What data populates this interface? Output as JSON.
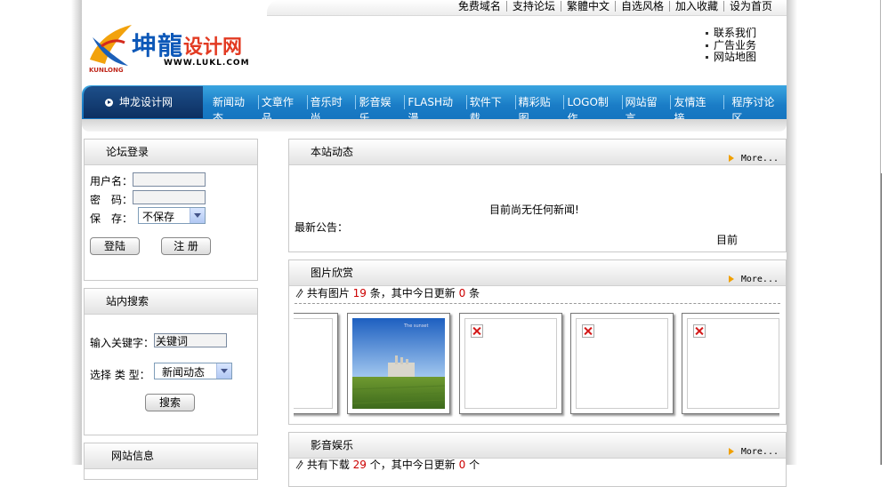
{
  "toplinks": [
    "免费域名",
    "支持论坛",
    "繁體中文",
    "自选风格",
    "加入收藏",
    "设为首页"
  ],
  "logo": {
    "cn": "坤龍",
    "design": "设计网",
    "url": "WWW.LUKL.COM",
    "en": "KUNLONG"
  },
  "quicklinks": [
    "联系我们",
    "广告业务",
    "网站地图"
  ],
  "nav": {
    "home": "坤龙设计网",
    "items": [
      "新闻动态",
      "文章作品",
      "音乐时尚",
      "影音娱乐",
      "FLASH动漫",
      "软件下载",
      "精彩贴图",
      "LOGO制作",
      "网站留言",
      "友情连接",
      "程序讨论区"
    ]
  },
  "login": {
    "title": "论坛登录",
    "username_label": "用户名：",
    "password_label": "密　码：",
    "save_label": "保　存：",
    "save_value": "不保存",
    "login_button": "登陆",
    "register_button": "注 册"
  },
  "search": {
    "title": "站内搜索",
    "keyword_label": "输入关键字：",
    "keyword_value": "关键词",
    "type_label": "选择 类 型：",
    "type_value": "新闻动态",
    "search_button": "搜索"
  },
  "siteinfo": {
    "title": "网站信息"
  },
  "news": {
    "title": "本站动态",
    "more": "More...",
    "empty": "目前尚无任何新闻!",
    "notice_label": "最新公告：",
    "notice_text": "目前"
  },
  "gallery": {
    "title": "图片欣赏",
    "more": "More...",
    "stat_prefix": "共有图片",
    "total": "19",
    "stat_mid": "条，其中今日更新",
    "today": "0",
    "stat_suffix": "条",
    "photo_caption": "The sunset"
  },
  "media": {
    "title": "影音娱乐",
    "more": "More...",
    "stat_prefix": "共有下载",
    "total": "29",
    "stat_mid": "个，其中今日更新",
    "today": "0",
    "stat_suffix": "个"
  }
}
